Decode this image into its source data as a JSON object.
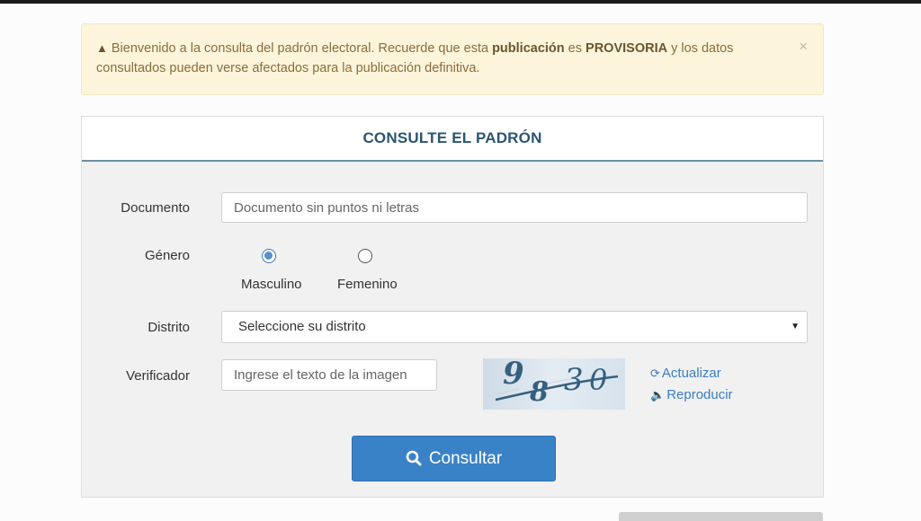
{
  "alert": {
    "text_before": "Bienvenido a la consulta del padrón electoral. Recuerde que esta ",
    "bold1": "publicación",
    "text_mid": " es ",
    "bold2": "PROVISORIA",
    "text_after": " y los datos consultados pueden verse afectados para la publicación definitiva.",
    "icon": "warning-icon",
    "close": "×"
  },
  "form": {
    "title": "CONSULTE EL PADRÓN",
    "documento": {
      "label": "Documento",
      "placeholder": "Documento sin puntos ni letras"
    },
    "genero": {
      "label": "Género",
      "options": [
        {
          "label": "Masculino",
          "checked": true
        },
        {
          "label": "Femenino",
          "checked": false
        }
      ]
    },
    "distrito": {
      "label": "Distrito",
      "selected": "Seleccione su distrito"
    },
    "verificador": {
      "label": "Verificador",
      "placeholder": "Ingrese el texto de la imagen",
      "captcha_text": "9830",
      "refresh_label": "Actualizar",
      "refresh_icon": "refresh-icon",
      "audio_label": "Reproducir",
      "audio_icon": "speaker-icon"
    },
    "submit_label": "Consultar",
    "submit_icon": "search-icon"
  },
  "colors": {
    "alert_bg": "#fcf5dc",
    "alert_text": "#8a6d3b",
    "title": "#2b5571",
    "button": "#3a82c8",
    "link": "#3b7dc4"
  }
}
